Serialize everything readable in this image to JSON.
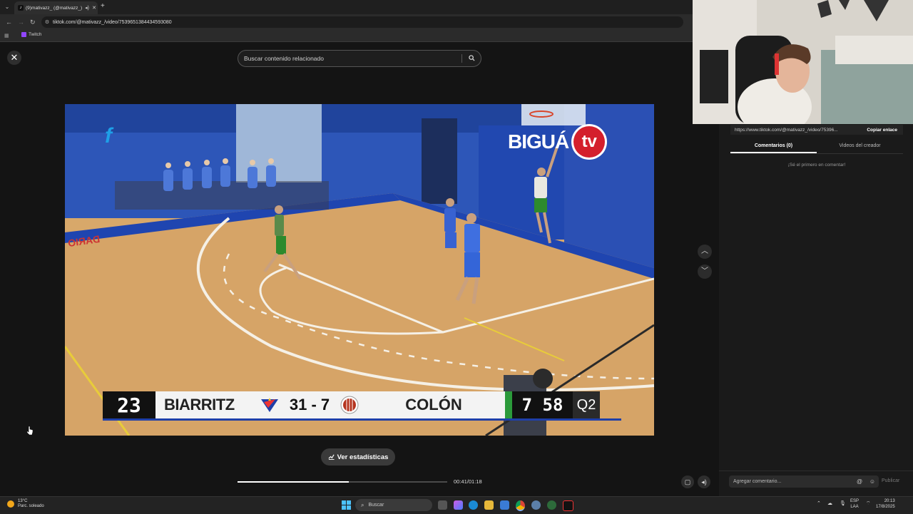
{
  "browser": {
    "tab_title": "(9)mativazz_ (@mativazz_) | TikTok",
    "url": "tiktok.com/@mativazz_/video/7539651384434593080",
    "bookmark": "Twitch"
  },
  "search": {
    "placeholder": "Buscar contenido relacionado"
  },
  "video": {
    "overlay_brand": "BIGUÁ",
    "overlay_brand_suffix": "tv",
    "left_logo": "f",
    "court_text": "DARIO",
    "scoreboard": {
      "shot_clock": "23",
      "home_team": "BIARRITZ",
      "score": "31 - 7",
      "away_team": "COLÓN",
      "game_clock": "7 58",
      "quarter": "Q2"
    }
  },
  "player": {
    "stats_button": "Ver estadísticas",
    "time": "00:41/01:18",
    "progress": 0.53
  },
  "sidebar": {
    "link": "https://www.tiktok.com/@mativazz_/video/75396...",
    "copy_label": "Copiar enlace",
    "tabs": [
      "Comentarios (0)",
      "Videos del creador"
    ],
    "empty_text": "¡Sé el primero en comentar!",
    "comment_placeholder": "Agregar comentario...",
    "publish_label": "Publicar"
  },
  "taskbar": {
    "temp": "13°C",
    "weather": "Parc. soleado",
    "search_label": "Buscar",
    "lang_top": "ESP",
    "lang_bottom": "LAA",
    "time": "20:13",
    "date": "17/8/2025"
  },
  "colors": {
    "accent_red": "#e01c2a",
    "court_blue": "#1f3fa8",
    "tiktok_bg": "#141414"
  }
}
